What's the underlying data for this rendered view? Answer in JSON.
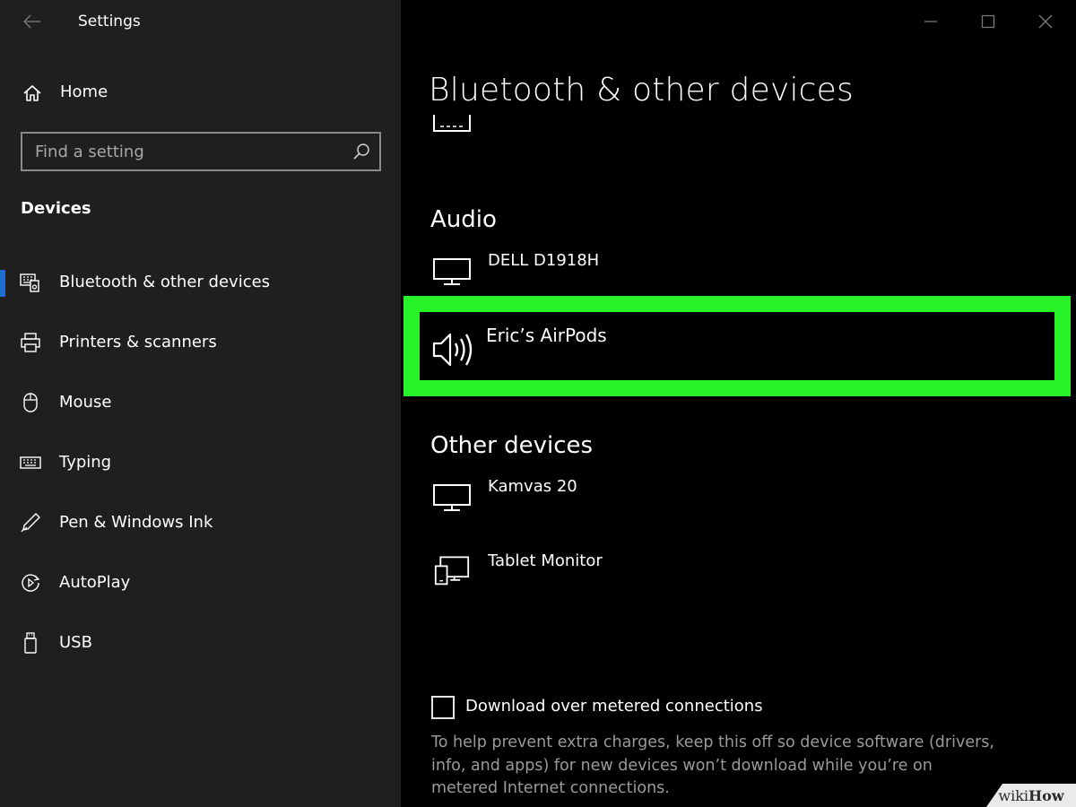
{
  "window": {
    "app_title": "Settings"
  },
  "sidebar": {
    "home_label": "Home",
    "search_placeholder": "Find a setting",
    "section_label": "Devices",
    "items": [
      {
        "label": "Bluetooth & other devices",
        "icon": "bluetooth-devices-icon",
        "active": true
      },
      {
        "label": "Printers & scanners",
        "icon": "printer-icon",
        "active": false
      },
      {
        "label": "Mouse",
        "icon": "mouse-icon",
        "active": false
      },
      {
        "label": "Typing",
        "icon": "keyboard-icon",
        "active": false
      },
      {
        "label": "Pen & Windows Ink",
        "icon": "pen-icon",
        "active": false
      },
      {
        "label": "AutoPlay",
        "icon": "autoplay-icon",
        "active": false
      },
      {
        "label": "USB",
        "icon": "usb-icon",
        "active": false
      }
    ]
  },
  "main": {
    "title": "Bluetooth & other devices",
    "audio": {
      "heading": "Audio",
      "devices": [
        {
          "name": "DELL D1918H",
          "icon": "monitor-icon"
        },
        {
          "name": "Eric’s AirPods",
          "icon": "speaker-icon",
          "highlighted": true
        }
      ]
    },
    "other": {
      "heading": "Other devices",
      "devices": [
        {
          "name": "Kamvas 20",
          "icon": "monitor-icon"
        },
        {
          "name": "Tablet Monitor",
          "icon": "tablet-monitor-icon"
        }
      ]
    },
    "metered": {
      "checkbox_label": "Download over metered connections",
      "checked": false,
      "help_text": "To help prevent extra charges, keep this off so device software (drivers, info, and apps) for new devices won’t download while you’re on metered Internet connections."
    }
  },
  "colors": {
    "highlight": "#27f227",
    "sidebar_bg": "#1f1f1f",
    "accent": "#1f6ed4"
  },
  "watermark": {
    "part1": "wiki",
    "part2": "How"
  }
}
